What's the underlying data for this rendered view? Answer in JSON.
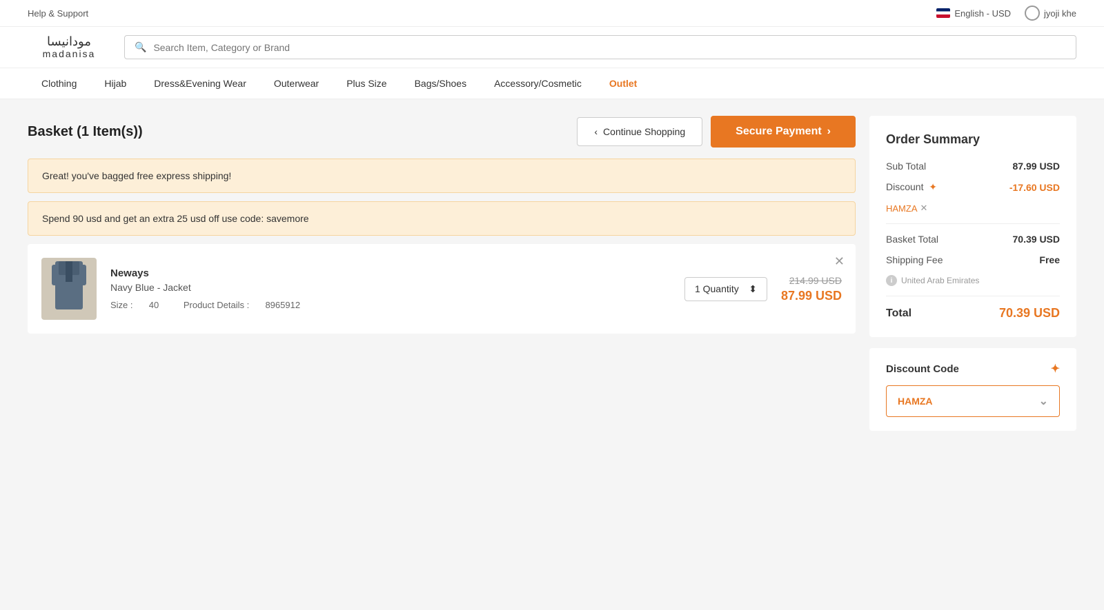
{
  "topbar": {
    "help_label": "Help & Support",
    "language": "English - USD",
    "username": "jyoji khe"
  },
  "header": {
    "logo_arabic": "مودانيسا",
    "logo_latin": "madanisa",
    "search_placeholder": "Search Item, Category or Brand"
  },
  "nav": {
    "items": [
      {
        "label": "Clothing",
        "outlet": false
      },
      {
        "label": "Hijab",
        "outlet": false
      },
      {
        "label": "Dress&Evening Wear",
        "outlet": false
      },
      {
        "label": "Outerwear",
        "outlet": false
      },
      {
        "label": "Plus Size",
        "outlet": false
      },
      {
        "label": "Bags/Shoes",
        "outlet": false
      },
      {
        "label": "Accessory/Cosmetic",
        "outlet": false
      },
      {
        "label": "Outlet",
        "outlet": true
      }
    ]
  },
  "basket": {
    "title": "Basket (1 Item(s))",
    "continue_label": "Continue Shopping",
    "secure_label": "Secure Payment",
    "notification1": "Great! you've bagged free express shipping!",
    "notification2": "Spend 90 usd and get an extra 25 usd off use code: savemore"
  },
  "cart_item": {
    "brand": "Neways",
    "name": "Navy Blue - Jacket",
    "size_label": "Size :",
    "size": "40",
    "details_label": "Product Details :",
    "details": "8965912",
    "quantity_label": "1 Quantity",
    "original_price": "214.99 USD",
    "sale_price": "87.99 USD"
  },
  "order_summary": {
    "title": "Order Summary",
    "subtotal_label": "Sub Total",
    "subtotal_value": "87.99 USD",
    "discount_label": "Discount",
    "discount_value": "-17.60 USD",
    "discount_code": "HAMZA",
    "basket_total_label": "Basket Total",
    "basket_total_value": "70.39 USD",
    "shipping_label": "Shipping Fee",
    "shipping_value": "Free",
    "shipping_region": "United Arab Emirates",
    "total_label": "Total",
    "total_value": "70.39 USD"
  },
  "discount_section": {
    "title": "Discount Code",
    "selected_code": "HAMZA"
  }
}
